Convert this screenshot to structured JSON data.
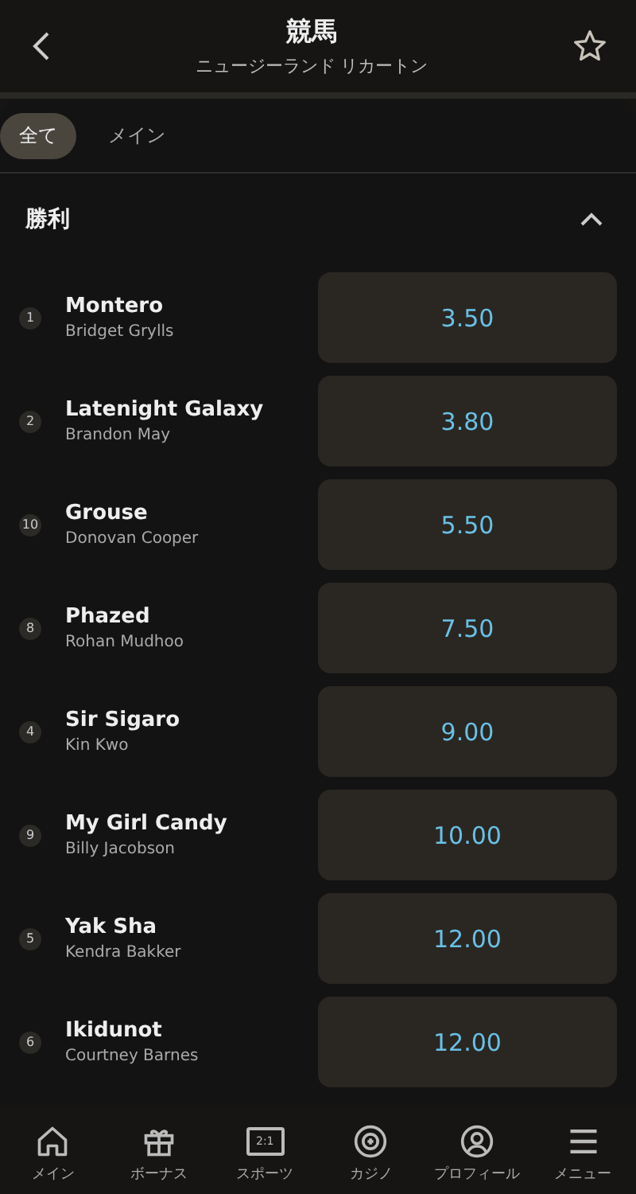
{
  "header": {
    "title": "競馬",
    "subtitle": "ニュージーランド リカートン",
    "favorite": false
  },
  "tabs": [
    {
      "label": "全て",
      "selected": true
    },
    {
      "label": "メイン",
      "selected": false
    }
  ],
  "market": {
    "title": "勝利",
    "expanded": true
  },
  "runners": [
    {
      "number": "1",
      "horse": "Montero",
      "jockey": "Bridget Grylls",
      "odds": "3.50"
    },
    {
      "number": "2",
      "horse": "Latenight Galaxy",
      "jockey": "Brandon May",
      "odds": "3.80"
    },
    {
      "number": "10",
      "horse": "Grouse",
      "jockey": "Donovan Cooper",
      "odds": "5.50"
    },
    {
      "number": "8",
      "horse": "Phazed",
      "jockey": "Rohan Mudhoo",
      "odds": "7.50"
    },
    {
      "number": "4",
      "horse": "Sir Sigaro",
      "jockey": "Kin Kwo",
      "odds": "9.00"
    },
    {
      "number": "9",
      "horse": "My Girl Candy",
      "jockey": "Billy Jacobson",
      "odds": "10.00"
    },
    {
      "number": "5",
      "horse": "Yak Sha",
      "jockey": "Kendra Bakker",
      "odds": "12.00"
    },
    {
      "number": "6",
      "horse": "Ikidunot",
      "jockey": "Courtney Barnes",
      "odds": "12.00"
    }
  ],
  "nav": [
    {
      "kind": "home",
      "label": "メイン"
    },
    {
      "kind": "gift",
      "label": "ボーナス"
    },
    {
      "kind": "score",
      "label": "スポーツ",
      "icon_text": "2:1"
    },
    {
      "kind": "chip",
      "label": "カジノ"
    },
    {
      "kind": "profile",
      "label": "プロフィール"
    },
    {
      "kind": "menu",
      "label": "メニュー"
    }
  ]
}
